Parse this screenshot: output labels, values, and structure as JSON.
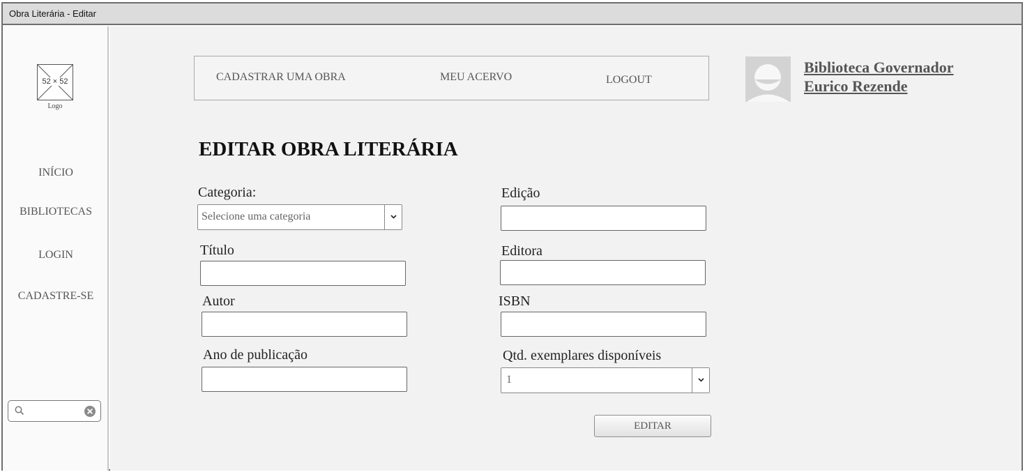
{
  "window": {
    "title": "Obra Literária - Editar"
  },
  "sidebar": {
    "logo_dims": "52 × 52",
    "logo_caption": "Logo",
    "items": [
      {
        "label": "INÍCIO"
      },
      {
        "label": "BIBLIOTECAS"
      },
      {
        "label": "LOGIN"
      },
      {
        "label": "CADASTRE-SE"
      }
    ],
    "search": {
      "value": ""
    }
  },
  "topnav": {
    "items": [
      {
        "label": "CADASTRAR UMA OBRA"
      },
      {
        "label": "MEU ACERVO"
      },
      {
        "label": "LOGOUT"
      }
    ]
  },
  "header": {
    "library_line1": "Biblioteca Governador",
    "library_line2": "Eurico Rezende"
  },
  "form": {
    "title": "EDITAR OBRA LITERÁRIA",
    "categoria": {
      "label": "Categoria:",
      "value": "Selecione uma categoria"
    },
    "titulo": {
      "label": "Título",
      "value": ""
    },
    "autor": {
      "label": "Autor",
      "value": ""
    },
    "ano": {
      "label": "Ano de publicação",
      "value": ""
    },
    "edicao": {
      "label": "Edição",
      "value": ""
    },
    "editora": {
      "label": "Editora",
      "value": ""
    },
    "isbn": {
      "label": "ISBN",
      "value": ""
    },
    "qtd": {
      "label": "Qtd. exemplares disponíveis",
      "value": "1"
    },
    "submit_label": "EDITAR"
  }
}
